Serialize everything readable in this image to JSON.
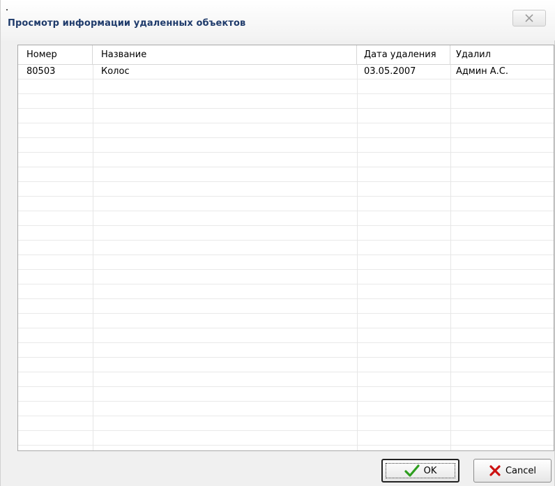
{
  "window": {
    "title": "Просмотр информации удаленных объектов",
    "close_glyph": "✕"
  },
  "table": {
    "columns": [
      "Номер",
      "Название",
      "Дата удаления",
      "Удалил"
    ],
    "rows": [
      [
        "80503",
        "Колос",
        "03.05.2007",
        "Админ А.С."
      ]
    ]
  },
  "buttons": {
    "ok_label": "OK",
    "cancel_label": "Cancel"
  },
  "icons": {
    "ok": "checkmark-icon",
    "cancel": "cross-icon",
    "close": "close-icon"
  },
  "colors": {
    "title_text": "#1f3b6b",
    "check_green": "#2e9e1f",
    "cross_red": "#cc1111"
  }
}
